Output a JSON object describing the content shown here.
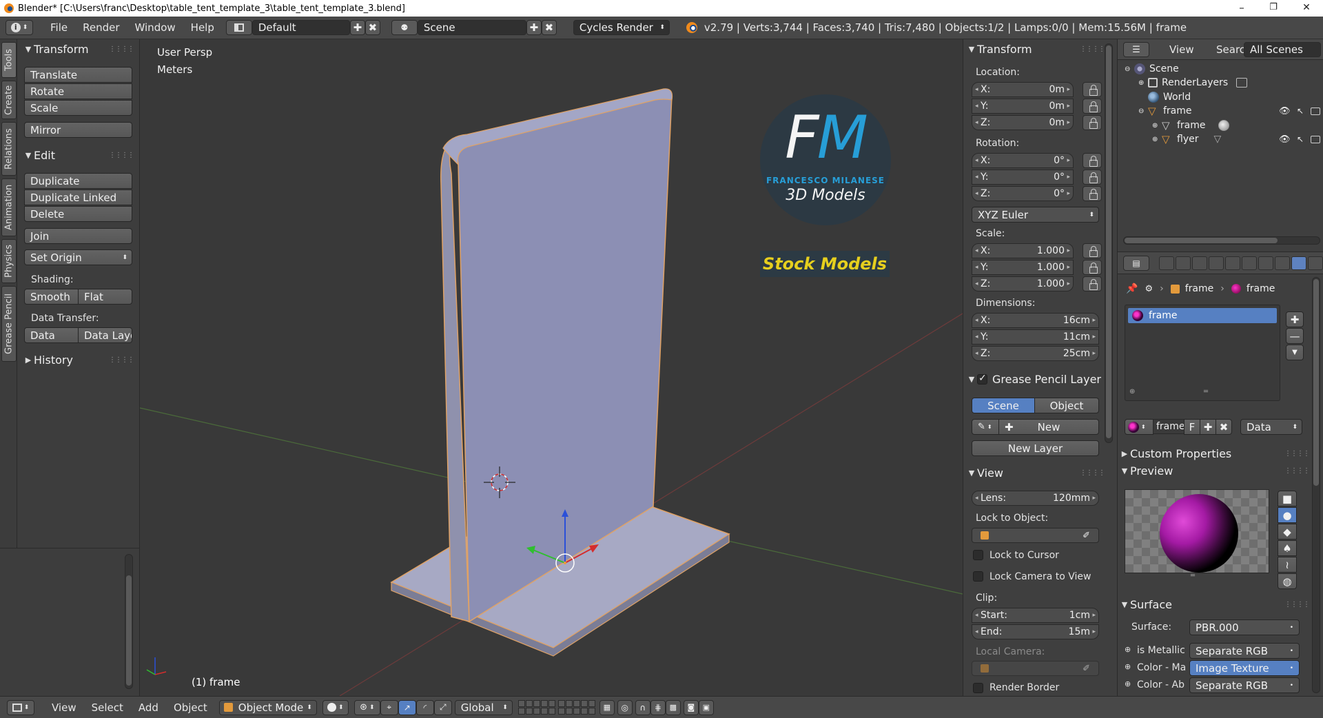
{
  "window": {
    "title": "Blender* [C:\\Users\\franc\\Desktop\\table_tent_template_3\\table_tent_template_3.blend]",
    "minimize": "–",
    "maximize": "❐",
    "close": "✕"
  },
  "top_header": {
    "menus": [
      "File",
      "Render",
      "Window",
      "Help"
    ],
    "screen_layout": "Default",
    "scene": "Scene",
    "render_engine": "Cycles Render",
    "stats": "v2.79 | Verts:3,744 | Faces:3,740 | Tris:7,480 | Objects:1/2 | Lamps:0/0 | Mem:15.56M | frame"
  },
  "tool_tabs": [
    "Tools",
    "Create",
    "Relations",
    "Animation",
    "Physics",
    "Grease Pencil"
  ],
  "tool_shelf": {
    "transform_title": "Transform",
    "transform_buttons": [
      "Translate",
      "Rotate",
      "Scale",
      "Mirror"
    ],
    "edit_title": "Edit",
    "edit_buttons": [
      "Duplicate",
      "Duplicate Linked",
      "Delete",
      "Join",
      "Set Origin"
    ],
    "shading_label": "Shading:",
    "shading_buttons": [
      "Smooth",
      "Flat"
    ],
    "data_transfer_label": "Data Transfer:",
    "data_transfer_buttons": [
      "Data",
      "Data Layo"
    ],
    "history_title": "History"
  },
  "viewport": {
    "view_name": "User Persp",
    "units": "Meters",
    "object_label": "(1) frame",
    "logo": {
      "initials_f": "F",
      "initials_m": "M",
      "name": "FRANCESCO MILANESE",
      "subtitle": "3D Models",
      "banner": "Stock Models",
      "accent_color": "#27a4e0",
      "banner_color": "#e6cf1e"
    }
  },
  "n_panel": {
    "transform_title": "Transform",
    "location_label": "Location:",
    "location": [
      {
        "k": "X:",
        "v": "0m"
      },
      {
        "k": "Y:",
        "v": "0m"
      },
      {
        "k": "Z:",
        "v": "0m"
      }
    ],
    "rotation_label": "Rotation:",
    "rotation": [
      {
        "k": "X:",
        "v": "0°"
      },
      {
        "k": "Y:",
        "v": "0°"
      },
      {
        "k": "Z:",
        "v": "0°"
      }
    ],
    "rotation_mode": "XYZ Euler",
    "scale_label": "Scale:",
    "scale": [
      {
        "k": "X:",
        "v": "1.000"
      },
      {
        "k": "Y:",
        "v": "1.000"
      },
      {
        "k": "Z:",
        "v": "1.000"
      }
    ],
    "dimensions_label": "Dimensions:",
    "dimensions": [
      {
        "k": "X:",
        "v": "16cm"
      },
      {
        "k": "Y:",
        "v": "11cm"
      },
      {
        "k": "Z:",
        "v": "25cm"
      }
    ],
    "grease_title": "Grease Pencil Layer",
    "grease_scene": "Scene",
    "grease_object": "Object",
    "grease_new": "New",
    "grease_new_layer": "New Layer",
    "view_title": "View",
    "lens": {
      "k": "Lens:",
      "v": "120mm"
    },
    "lock_to_object_label": "Lock to Object:",
    "lock_to_cursor": "Lock to Cursor",
    "lock_camera": "Lock Camera to View",
    "clip_label": "Clip:",
    "clip_start": {
      "k": "Start:",
      "v": "1cm"
    },
    "clip_end": {
      "k": "End:",
      "v": "15m"
    },
    "local_camera_label": "Local Camera:",
    "render_border": "Render Border"
  },
  "outliner": {
    "menus": [
      "View",
      "Search"
    ],
    "filter": "All Scenes",
    "rows": [
      "Scene",
      "RenderLayers",
      "World",
      "frame",
      "frame",
      "flyer"
    ]
  },
  "properties": {
    "breadcrumb_object": "frame",
    "breadcrumb_material": "frame",
    "material_slot": "frame",
    "material_name": "frame",
    "material_f": "F",
    "link_mode": "Data",
    "custom_properties": "Custom Properties",
    "preview_title": "Preview",
    "surface_title": "Surface",
    "surface_label": "Surface:",
    "surface_value": "PBR.000",
    "inputs": [
      {
        "k": "is Metallic",
        "v": "Separate RGB"
      },
      {
        "k": "Color - Ma",
        "v": "Image Texture"
      },
      {
        "k": "Color - Ab",
        "v": "Separate RGB"
      }
    ]
  },
  "bottom_header": {
    "menus": [
      "View",
      "Select",
      "Add",
      "Object"
    ],
    "mode": "Object Mode",
    "orientation": "Global"
  }
}
